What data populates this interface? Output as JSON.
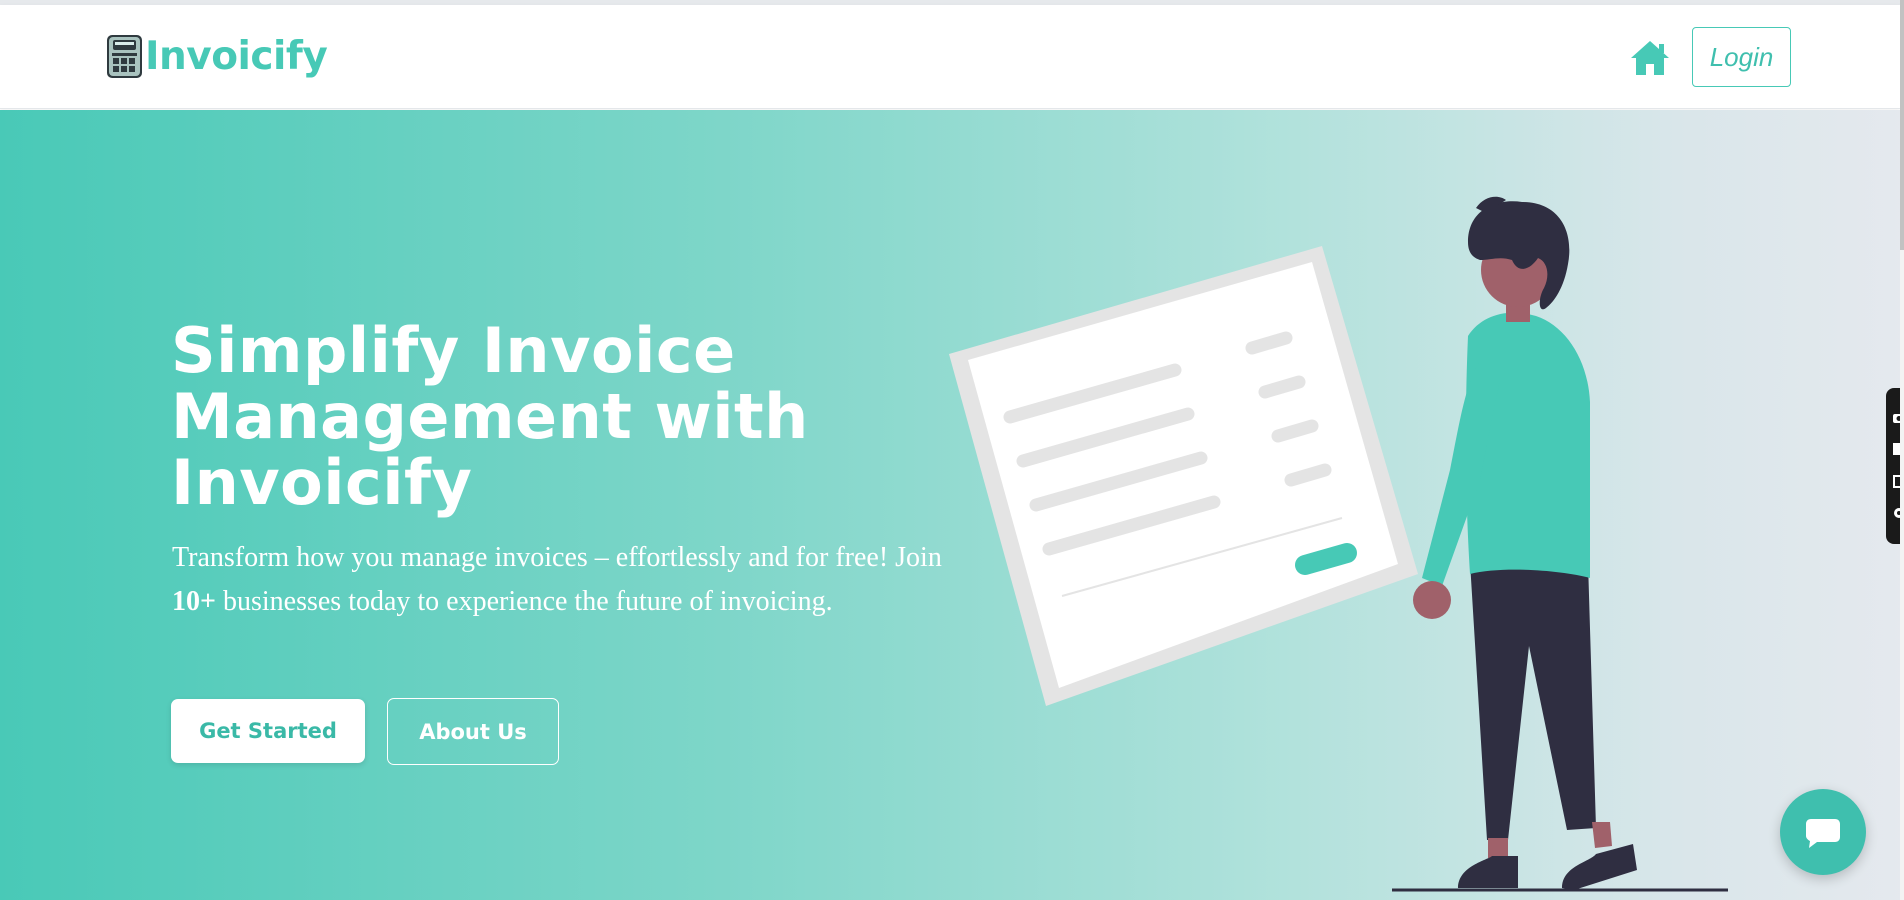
{
  "brand": {
    "name": "Invoicify",
    "logo_icon": "invoice-calculator-logo"
  },
  "nav": {
    "home_icon": "home-icon",
    "login_label": "Login"
  },
  "hero": {
    "title": "Simplify Invoice Management with Invoicify",
    "desc_before": "Transform how you manage invoices – effortlessly and for free! Join ",
    "desc_count": "10+",
    "desc_after": " businesses today to experience the future of invoicing.",
    "get_started_label": "Get Started",
    "about_label": "About Us"
  },
  "colors": {
    "accent": "#47c9b6",
    "gradient_start": "#49c9b7",
    "gradient_end": "#e5e9ee",
    "text_light": "#ffffff"
  },
  "illustration": {
    "subject": "person-holding-invoice"
  },
  "toolbar": {
    "icons": [
      "camera-icon",
      "square-icon",
      "window-icon",
      "gear-icon"
    ]
  },
  "chat": {
    "icon": "chat-bubble-icon"
  }
}
